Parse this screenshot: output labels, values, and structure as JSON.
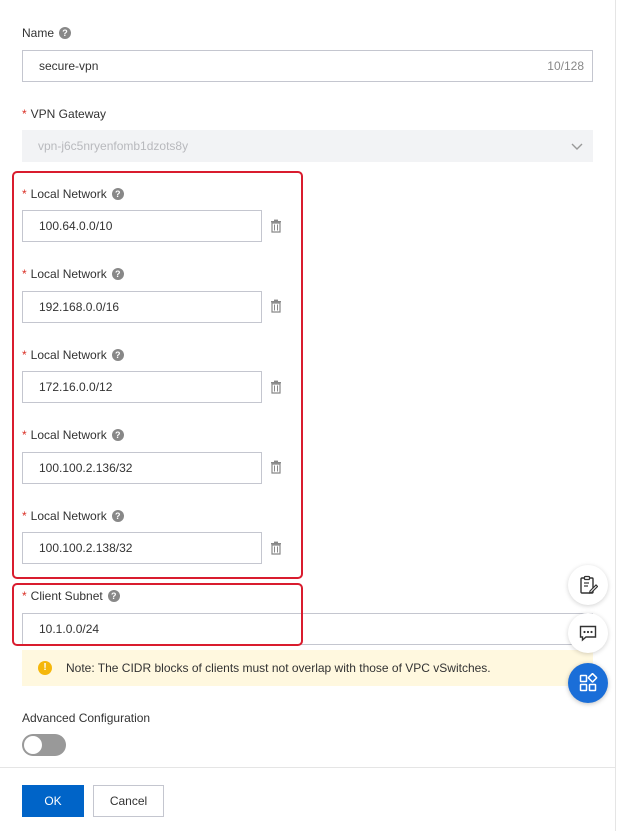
{
  "form": {
    "name": {
      "label": "Name",
      "value": "secure-vpn",
      "counter": "10/128"
    },
    "vpn_gateway": {
      "label": "VPN Gateway",
      "value": "vpn-j6c5nryenfomb1dzots8y"
    },
    "local_networks": [
      {
        "label": "Local Network",
        "value": "100.64.0.0/10"
      },
      {
        "label": "Local Network",
        "value": "192.168.0.0/16"
      },
      {
        "label": "Local Network",
        "value": "172.16.0.0/12"
      },
      {
        "label": "Local Network",
        "value": "100.100.2.136/32"
      },
      {
        "label": "Local Network",
        "value": "100.100.2.138/32"
      }
    ],
    "client_subnet": {
      "label": "Client Subnet",
      "value": "10.1.0.0/24"
    },
    "note": "Note: The CIDR blocks of clients must not overlap with those of VPC vSwitches.",
    "advanced_label": "Advanced Configuration",
    "advanced_enabled": false,
    "required_mark": "*",
    "help_glyph": "?",
    "warn_glyph": "!"
  },
  "footer": {
    "ok_label": "OK",
    "cancel_label": "Cancel"
  },
  "floating_actions": [
    "form-edit-icon",
    "chat-icon",
    "apps-icon"
  ],
  "colors": {
    "primary": "#0064c8",
    "highlight": "#d91c2e",
    "note_bg": "#fff8df",
    "warning": "#f5b70b"
  }
}
